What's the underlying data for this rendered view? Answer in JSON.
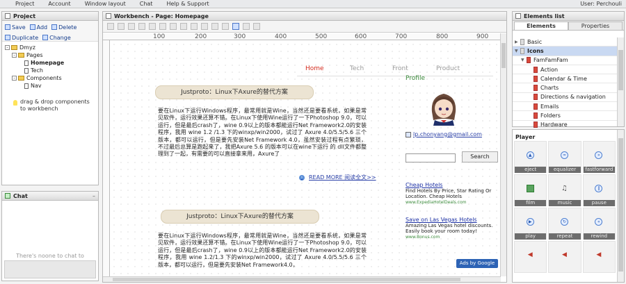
{
  "menubar": {
    "items": [
      "Project",
      "Account",
      "Window layout",
      "Chat",
      "Help & Support"
    ],
    "user": "User: Perchouli"
  },
  "project_panel": {
    "title": "Project",
    "toolbar": [
      "Save",
      "Add",
      "Delete",
      "Duplicate",
      "Change"
    ],
    "tree": {
      "root": "Dmyz",
      "pages": "Pages",
      "homepage": "Homepage",
      "tech": "Tech",
      "components": "Components",
      "nav": "Nav"
    },
    "hint": "drag & drop components to workbench"
  },
  "chat_panel": {
    "title": "Chat",
    "empty_message": "There's noone to chat to"
  },
  "workbench": {
    "title": "Workbench - Page: Homepage",
    "ruler_numbers": [
      "100",
      "200",
      "300",
      "400",
      "500",
      "600",
      "700",
      "800",
      "900"
    ],
    "nav": [
      "Home",
      "Tech",
      "Front",
      "Product"
    ],
    "post1": {
      "title": "Justproto：Linux下Axure的替代方案",
      "body": "要在Linux下运行Windows程序，最常用就是Wine，当然还是要看系统，如果是常见软件，运行效果还算不错。在Linux下使用Wine运行了一下Photoshop 9.0，可以运行，但是最后crash了，wine 0.9以上的版本都能运行Net Framework2.0的安装程序，我用 wine 1.2 /1.3 下的winxp/win2000，试过了 Axure 4.0/5.5/5.6 三个版本，都可以运行，但是要先安装Net Framework 4.0，虽然安装过程有点繁琐，不过最后总算是跑起来了，我把Axure 5.6 的版本可以在wine下运行 的 dll文件都整理到了一起，有需要的可以直接拿来用，Axure了",
      "read_more": "READ MORE 阅读全文>>"
    },
    "post2": {
      "title": "Justproto：Linux下Axure的替代方案",
      "body": "要在Linux下运行Windows程序，最常用就是Wine，当然还是要看系统，如果是常见软件，运行效果还算不错。在Linux下使用Wine运行了一下Photoshop 9.0，可以运行，但是最后crash了，wine 0.9以上的版本都能运行Net Framework2.0的安装程序，我用 wine 1.2/1.3 下的winxp/win2000，试过了 Axure 4.0/5.5/5.6 三个版本，都可以运行，但是要先安装Net Framework4.0，"
    },
    "sidebar": {
      "profile": "Profile",
      "email": "lp.chonyang@gmail.com",
      "search_button": "Search",
      "ads": [
        {
          "title": "Cheap Hotels",
          "text": "Find Hotels By Price, Star Rating Or Location. Cheap Hotels",
          "url": "www.ExpediaHotelDeals.com"
        },
        {
          "title": "Save on Las Vegas Hotels",
          "text": "Amazing Las Vegas hotel discounts. Easily book your room today!",
          "url": "www.Bonus.com"
        }
      ],
      "ads_by": "Ads by Google"
    }
  },
  "elements_panel": {
    "title": "Elements list",
    "tabs": [
      "Elements",
      "Properties"
    ],
    "items": [
      "Basic",
      "Icons",
      "FamFamFam",
      "Action",
      "Calendar & Time",
      "Charts",
      "Directions & navigation",
      "Emails",
      "Folders",
      "Hardware"
    ]
  },
  "player_panel": {
    "title": "Player",
    "cells": [
      {
        "label": "eject",
        "icon": "eject-icon",
        "glyph": "▲"
      },
      {
        "label": "equalizer",
        "icon": "equalizer-icon",
        "glyph": "≈"
      },
      {
        "label": "fastforward",
        "icon": "fastforward-icon",
        "glyph": "»"
      },
      {
        "label": "film",
        "icon": "film-icon",
        "glyph": ""
      },
      {
        "label": "music",
        "icon": "music-icon",
        "glyph": "♫"
      },
      {
        "label": "pause",
        "icon": "pause-icon",
        "glyph": "‖"
      },
      {
        "label": "play",
        "icon": "play-icon",
        "glyph": "▶"
      },
      {
        "label": "repeat",
        "icon": "repeat-icon",
        "glyph": "↻"
      },
      {
        "label": "rewind",
        "icon": "rewind-icon",
        "glyph": "«"
      },
      {
        "label": "",
        "icon": "speaker-icon",
        "glyph": "◀"
      },
      {
        "label": "",
        "icon": "speaker-icon",
        "glyph": "◀"
      },
      {
        "label": "",
        "icon": "speaker-icon",
        "glyph": "◀"
      }
    ]
  },
  "colors": {
    "nav_active": "#d42a1c",
    "profile_green": "#3a8a3a",
    "link_blue": "#2b41a8",
    "selection": "#c9d9f2"
  }
}
